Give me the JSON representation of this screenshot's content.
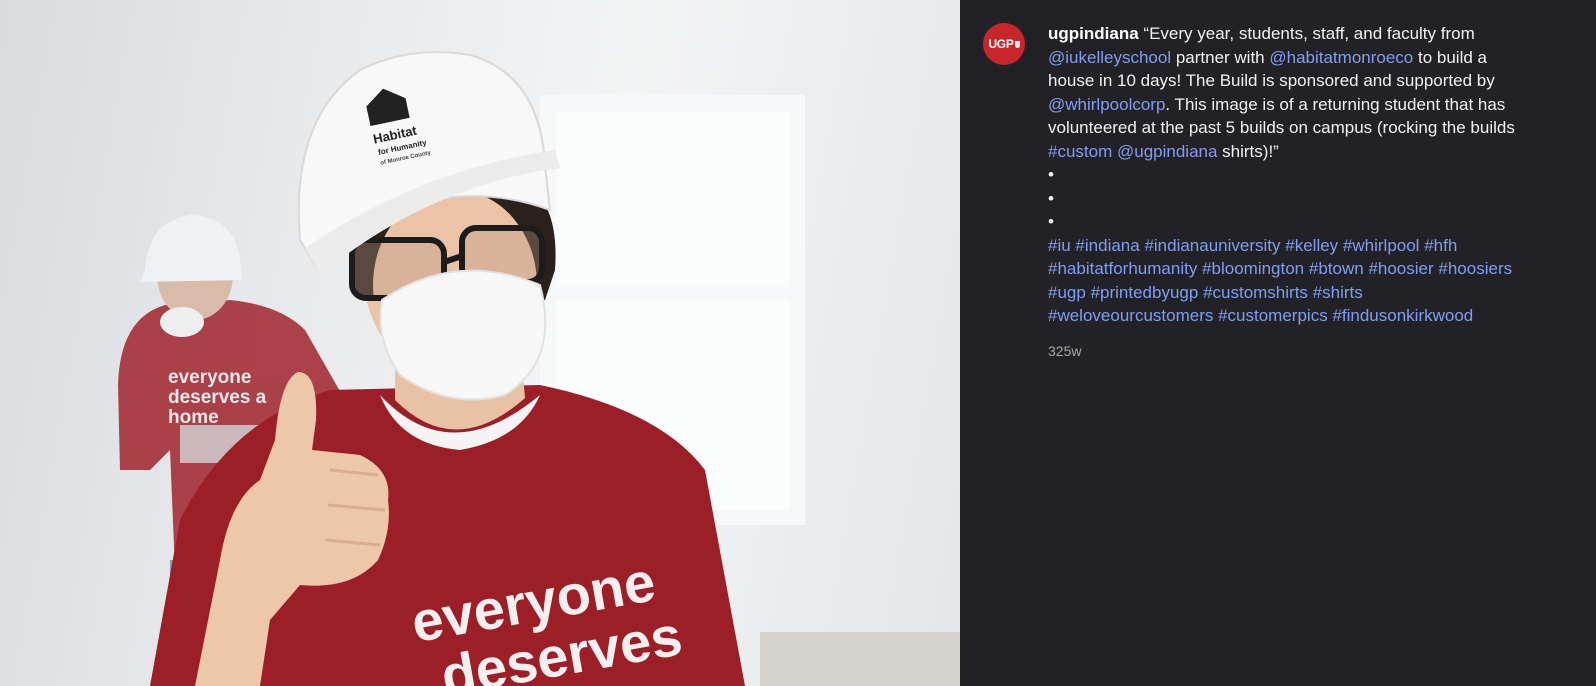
{
  "post": {
    "username": "ugpindiana",
    "avatar_text": "UGP",
    "timestamp": "325w",
    "caption_lines": [
      [
        {
          "t": "Every year, students, staff, and faculty from",
          "k": "text",
          "q": "“"
        }
      ],
      [
        {
          "t": "@iukelleyschool",
          "k": "link"
        },
        {
          "t": " partner with ",
          "k": "text"
        },
        {
          "t": "@habitatmonroeco",
          "k": "link"
        },
        {
          "t": " to build a",
          "k": "text"
        }
      ],
      [
        {
          "t": "house in 10 days! The Build is sponsored and supported by",
          "k": "text"
        }
      ],
      [
        {
          "t": "@whirlpoolcorp",
          "k": "link"
        },
        {
          "t": ". This image is of a returning student that has",
          "k": "text"
        }
      ],
      [
        {
          "t": "volunteered at the past 5 builds on campus (rocking the builds",
          "k": "text"
        }
      ],
      [
        {
          "t": "#custom",
          "k": "link"
        },
        {
          "t": " ",
          "k": "text"
        },
        {
          "t": "@ugpindiana",
          "k": "link"
        },
        {
          "t": " shirts)!”",
          "k": "text"
        }
      ]
    ],
    "bullets": [
      "•",
      "•",
      "•"
    ],
    "hashtag_lines": [
      [
        "#iu",
        "#indiana",
        "#indianauniversity",
        "#kelley",
        "#whirlpool",
        "#hfh"
      ],
      [
        "#habitatforhumanity",
        "#bloomington",
        "#btown",
        "#hoosier",
        "#hoosiers"
      ],
      [
        "#ugp",
        "#printedbyugp",
        "#customshirts",
        "#shirts"
      ],
      [
        "#weloveourcustomers",
        "#customerpics",
        "#findusonkirkwood"
      ]
    ]
  },
  "photo": {
    "helmet_logo_line1": "Habitat",
    "helmet_logo_line2": "for Humanity",
    "helmet_logo_line3": "of Monroe County",
    "shirt_text_line1": "everyone",
    "shirt_text_line2": "deserves",
    "bg_shirt_line1": "everyone",
    "bg_shirt_line2": "deserves a",
    "bg_shirt_line3": "home"
  },
  "colors": {
    "panel_bg": "#222226",
    "link": "#7f9ef3",
    "text": "#f2f2f2",
    "muted": "#a8a8a8",
    "avatar_red": "#c8262b",
    "shirt_red": "#9c1f27"
  }
}
